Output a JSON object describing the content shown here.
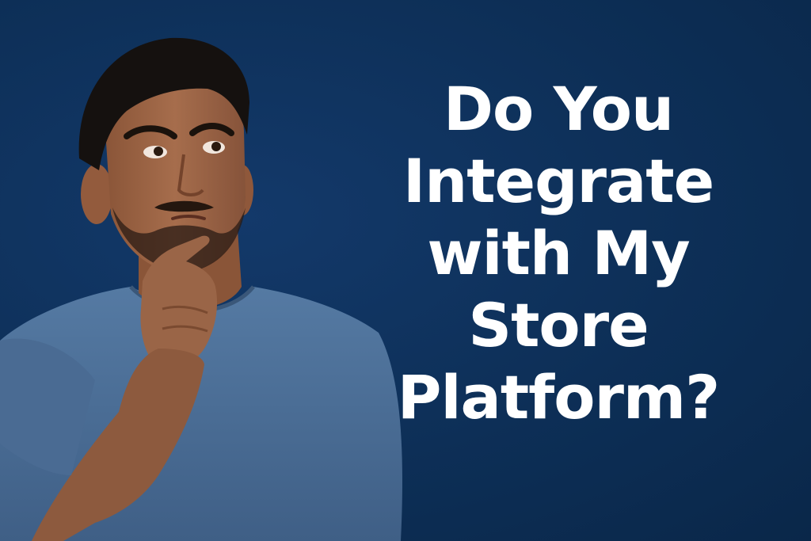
{
  "colors": {
    "background": "#0d2f57",
    "text": "#ffffff",
    "shirt": "#4a6b93",
    "skin": "#9a6547",
    "hair": "#15110f"
  },
  "image": {
    "subject": "thinking-man-photo"
  },
  "headline": {
    "lines": [
      "Do You",
      "Integrate",
      "with My",
      "Store",
      "Platform?"
    ]
  }
}
